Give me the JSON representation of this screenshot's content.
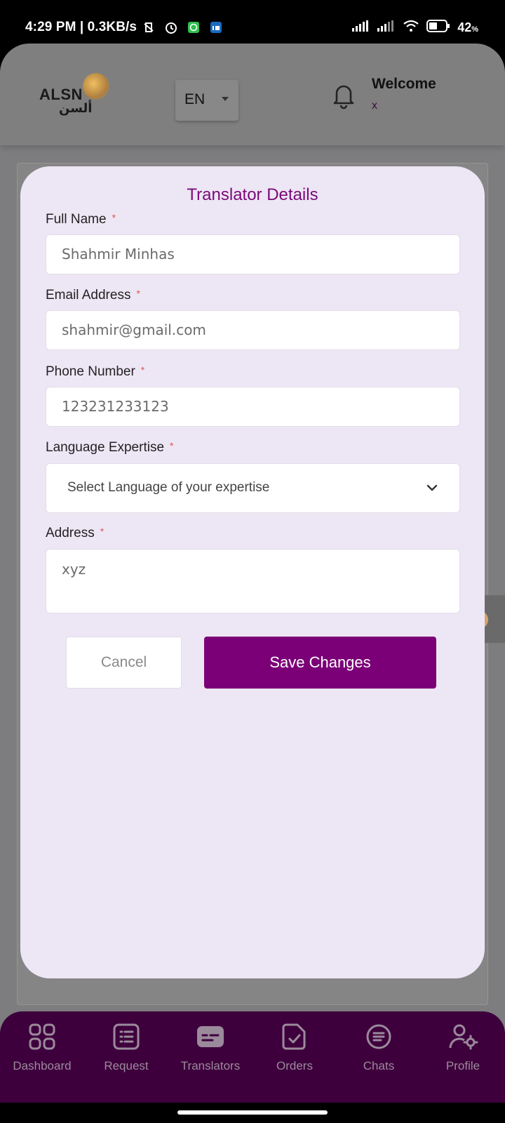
{
  "status_bar": {
    "time": "4:29 PM | 0.3KB/s",
    "battery": "42",
    "battery_unit": "%"
  },
  "header": {
    "logo_text": "ALSN",
    "logo_arabic": "ألسن",
    "language": "EN",
    "welcome": "Welcome",
    "user_name": "x"
  },
  "modal": {
    "title": "Translator Details",
    "fields": {
      "full_name": {
        "label": "Full Name",
        "value": "Shahmir Minhas"
      },
      "email": {
        "label": "Email Address",
        "value": "shahmir@gmail.com"
      },
      "phone": {
        "label": "Phone Number",
        "value": "123231233123"
      },
      "language": {
        "label": "Language Expertise",
        "placeholder": "Select Language of your expertise"
      },
      "address": {
        "label": "Address",
        "value": "xyz"
      }
    },
    "required_mark": "*",
    "cancel_label": "Cancel",
    "save_label": "Save Changes"
  },
  "nav": {
    "items": [
      {
        "label": "Dashboard",
        "icon": "grid-icon"
      },
      {
        "label": "Request",
        "icon": "list-icon"
      },
      {
        "label": "Translators",
        "icon": "id-card-icon"
      },
      {
        "label": "Orders",
        "icon": "document-check-icon"
      },
      {
        "label": "Chats",
        "icon": "chat-icon"
      },
      {
        "label": "Profile",
        "icon": "user-gear-icon"
      }
    ]
  },
  "colors": {
    "brand": "#7b0077",
    "nav_bg": "#3e003d",
    "modal_bg": "#ede6f5"
  }
}
